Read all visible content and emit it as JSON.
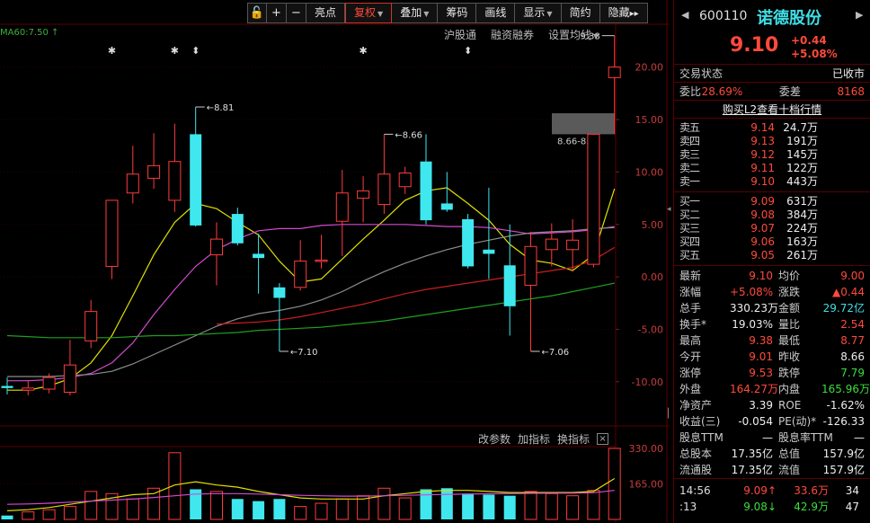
{
  "toolbar": {
    "buttons": [
      {
        "label": "亮点"
      },
      {
        "label": "复权",
        "active": true,
        "caret": true
      },
      {
        "label": "叠加",
        "caret": true
      },
      {
        "label": "筹码"
      },
      {
        "label": "画线"
      },
      {
        "label": "显示",
        "caret": true
      },
      {
        "label": "简约"
      },
      {
        "label": "隐藏"
      }
    ],
    "hide_arrows": "▸▸"
  },
  "ma60_label": "MA60:7.50",
  "ma60_arrow": "↑",
  "sublinks": [
    "沪股通",
    "融资融券",
    "设置均线"
  ],
  "indicator_bar": [
    "改参数",
    "加指标",
    "换指标"
  ],
  "indicator_close": "×",
  "chart_data": {
    "type": "candlestick",
    "y_axis_ticks": [
      "20.00",
      "15.00",
      "10.00",
      "5.00",
      "0.00",
      "-5.00",
      "-10.00"
    ],
    "y_axis_values": [
      20,
      15,
      10,
      5,
      0,
      -5,
      -10
    ],
    "ylim": [
      -11.3,
      22.8
    ],
    "volume_axis_ticks": [
      "330.00",
      "165.00"
    ],
    "volume_axis_values": [
      330,
      165
    ],
    "volume_ylim": [
      0,
      330
    ],
    "candles": [
      {
        "o": -10.4,
        "h": -9.6,
        "l": -11.2,
        "c": -10.6,
        "up": false
      },
      {
        "o": -10.8,
        "h": -9.9,
        "l": -11.3,
        "c": -10.6,
        "up": true
      },
      {
        "o": -10.7,
        "h": -9.2,
        "l": -11.1,
        "c": -9.6,
        "up": true
      },
      {
        "o": -11.0,
        "h": -6.0,
        "l": -11.3,
        "c": -8.4,
        "up": true
      },
      {
        "o": -6.1,
        "h": -2.2,
        "l": -6.8,
        "c": -3.3,
        "up": true
      },
      {
        "o": 1.0,
        "h": 7.2,
        "l": -0.2,
        "c": 7.3,
        "up": true
      },
      {
        "o": 8.0,
        "h": 12.5,
        "l": 7.0,
        "c": 9.8,
        "up": true
      },
      {
        "o": 10.6,
        "h": 13.7,
        "l": 8.4,
        "c": 9.4,
        "up": true
      },
      {
        "o": 7.3,
        "h": 14.6,
        "l": 6.2,
        "c": 11.0,
        "up": true
      },
      {
        "o": 13.6,
        "h": 16.2,
        "l": 4.8,
        "c": 4.9,
        "up": false
      },
      {
        "o": 2.1,
        "h": 5.2,
        "l": -0.8,
        "c": 3.6,
        "up": true
      },
      {
        "o": 6.0,
        "h": 6.6,
        "l": 3.0,
        "c": 3.2,
        "up": false
      },
      {
        "o": 2.2,
        "h": 4.1,
        "l": -1.6,
        "c": 1.8,
        "up": false
      },
      {
        "o": -1.0,
        "h": -0.6,
        "l": -7.1,
        "c": -2.0,
        "up": false
      },
      {
        "o": -1.0,
        "h": 3.5,
        "l": -1.3,
        "c": 1.5,
        "up": true
      },
      {
        "o": 1.6,
        "h": 4.0,
        "l": 0.8,
        "c": 1.5,
        "up": true
      },
      {
        "o": 5.3,
        "h": 10.2,
        "l": 2.0,
        "c": 8.0,
        "up": true
      },
      {
        "o": 7.5,
        "h": 9.6,
        "l": 5.2,
        "c": 8.2,
        "up": true
      },
      {
        "o": 6.9,
        "h": 13.6,
        "l": 6.0,
        "c": 9.8,
        "up": true
      },
      {
        "o": 8.6,
        "h": 10.5,
        "l": 7.9,
        "c": 9.9,
        "up": true
      },
      {
        "o": 11.0,
        "h": 13.6,
        "l": 5.0,
        "c": 5.4,
        "up": false
      },
      {
        "o": 7.0,
        "h": 10.0,
        "l": 6.2,
        "c": 6.4,
        "up": false
      },
      {
        "o": 5.5,
        "h": 6.0,
        "l": 0.8,
        "c": 1.0,
        "up": false
      },
      {
        "o": 2.6,
        "h": 8.5,
        "l": -0.2,
        "c": 2.2,
        "up": false
      },
      {
        "o": 1.1,
        "h": 5.0,
        "l": -5.6,
        "c": -2.8,
        "up": false
      },
      {
        "o": -0.8,
        "h": 4.3,
        "l": -7.1,
        "c": 2.9,
        "up": true
      },
      {
        "o": 2.6,
        "h": 5.1,
        "l": 1.0,
        "c": 3.6,
        "up": true
      },
      {
        "o": 2.6,
        "h": 5.5,
        "l": 0.5,
        "c": 3.5,
        "up": true
      },
      {
        "o": 1.2,
        "h": 13.6,
        "l": 0.9,
        "c": 13.6,
        "up": true
      },
      {
        "o": 19.0,
        "h": 23.0,
        "l": 13.6,
        "c": 20.0,
        "up": true
      }
    ],
    "ma_lines": [
      {
        "color": "#e0e000",
        "values": [
          -10.8,
          -10.8,
          -10.4,
          -9.7,
          -8.2,
          -5.6,
          -1.8,
          2.1,
          5.2,
          7.0,
          6.5,
          5.2,
          4.0,
          1.5,
          -0.5,
          -0.2,
          1.7,
          3.6,
          5.4,
          7.3,
          8.2,
          8.5,
          7.0,
          5.4,
          3.1,
          1.6,
          1.3,
          0.6,
          2.1,
          8.4
        ]
      },
      {
        "color": "#d14bd1",
        "values": [
          -9.9,
          -9.9,
          -9.8,
          -9.6,
          -9.2,
          -8.2,
          -6.3,
          -3.6,
          -1.2,
          1.0,
          2.6,
          3.6,
          4.4,
          4.6,
          4.6,
          4.9,
          5.0,
          5.0,
          5.0,
          5.0,
          4.9,
          4.8,
          4.8,
          4.7,
          4.4,
          4.1,
          4.2,
          4.3,
          4.5,
          4.8
        ]
      },
      {
        "color": "#8c8c8c",
        "values": [
          -9.5,
          -9.5,
          -9.5,
          -9.4,
          -9.3,
          -9.0,
          -8.3,
          -7.4,
          -6.5,
          -5.6,
          -4.7,
          -4.0,
          -3.5,
          -3.2,
          -2.8,
          -2.2,
          -1.4,
          -0.4,
          0.5,
          1.3,
          2.0,
          2.6,
          3.1,
          3.5,
          3.9,
          4.2,
          4.3,
          4.4,
          4.6,
          4.7
        ]
      },
      {
        "color": "#c81e1e",
        "values": [
          null,
          null,
          null,
          null,
          null,
          null,
          null,
          null,
          null,
          null,
          -4.5,
          -4.4,
          -4.3,
          -4.1,
          -3.8,
          -3.4,
          -3.0,
          -2.6,
          -2.1,
          -1.6,
          -1.2,
          -0.9,
          -0.6,
          -0.3,
          0.0,
          0.3,
          0.6,
          0.9,
          1.6,
          2.8
        ]
      },
      {
        "color": "#1f9e1f",
        "values": [
          -5.6,
          -5.7,
          -5.8,
          -5.8,
          -5.8,
          -5.8,
          -5.7,
          -5.6,
          -5.6,
          -5.5,
          -5.4,
          -5.3,
          -5.1,
          -5.0,
          -4.9,
          -4.8,
          -4.6,
          -4.4,
          -4.2,
          -3.9,
          -3.6,
          -3.3,
          -3.0,
          -2.7,
          -2.4,
          -2.1,
          -1.8,
          -1.4,
          -1.0,
          -0.6
        ]
      }
    ],
    "volume": [
      18,
      35,
      45,
      60,
      130,
      120,
      95,
      145,
      310,
      140,
      130,
      95,
      85,
      95,
      60,
      75,
      95,
      110,
      145,
      100,
      140,
      145,
      120,
      115,
      110,
      130,
      120,
      110,
      135,
      330
    ],
    "vol_ma": [
      {
        "color": "#e0e000",
        "values": [
          40,
          45,
          55,
          70,
          85,
          100,
          115,
          120,
          160,
          175,
          160,
          150,
          130,
          115,
          100,
          95,
          95,
          95,
          110,
          120,
          130,
          135,
          135,
          130,
          125,
          125,
          125,
          125,
          130,
          190
        ]
      },
      {
        "color": "#d14bd1",
        "values": [
          70,
          72,
          75,
          80,
          85,
          90,
          95,
          102,
          110,
          118,
          120,
          120,
          118,
          115,
          112,
          110,
          108,
          108,
          110,
          112,
          114,
          116,
          118,
          119,
          120,
          121,
          122,
          122,
          124,
          135
        ]
      }
    ],
    "annotations": [
      {
        "text": "8.81",
        "candle": 9,
        "value": 16.2,
        "anchor": "high"
      },
      {
        "text": "8.66",
        "candle": 18,
        "value": 13.6,
        "anchor": "high"
      },
      {
        "text": "7.10",
        "candle": 13,
        "value": -7.1,
        "anchor": "low"
      },
      {
        "text": "7.06",
        "candle": 25,
        "value": -7.1,
        "anchor": "low"
      },
      {
        "text": "9.38",
        "candle": 29,
        "value": 23.0,
        "anchor": "high-left"
      }
    ],
    "price_band_label": "8.66-8.77",
    "markers": [
      {
        "candle": 5,
        "glyph": "✱"
      },
      {
        "candle": 8,
        "glyph": "✱"
      },
      {
        "candle": 9,
        "glyph": "⬍"
      },
      {
        "candle": 17,
        "glyph": "✱"
      },
      {
        "candle": 22,
        "glyph": "⬍"
      }
    ]
  },
  "panel": {
    "code": "600110",
    "name": "诺德股份",
    "price": "9.10",
    "change": "+0.44",
    "change_pct": "+5.08%",
    "status_label": "交易状态",
    "status_value": "已收市",
    "ratio_label": "委比",
    "ratio_value": "28.69%",
    "diff_label": "委差",
    "diff_value": "8168",
    "l2_link": "购买L2查看十档行情",
    "asks": [
      {
        "label": "卖五",
        "price": "9.14",
        "vol": "24.7万"
      },
      {
        "label": "卖四",
        "price": "9.13",
        "vol": "191万"
      },
      {
        "label": "卖三",
        "price": "9.12",
        "vol": "145万"
      },
      {
        "label": "卖二",
        "price": "9.11",
        "vol": "122万"
      },
      {
        "label": "卖一",
        "price": "9.10",
        "vol": "443万"
      }
    ],
    "bids": [
      {
        "label": "买一",
        "price": "9.09",
        "vol": "631万"
      },
      {
        "label": "买二",
        "price": "9.08",
        "vol": "384万"
      },
      {
        "label": "买三",
        "price": "9.07",
        "vol": "224万"
      },
      {
        "label": "买四",
        "price": "9.06",
        "vol": "163万"
      },
      {
        "label": "买五",
        "price": "9.05",
        "vol": "261万"
      }
    ],
    "quotes": [
      {
        "a": "最新",
        "b": "9.10",
        "bc": "red",
        "c": "均价",
        "d": "9.00",
        "dc": "red"
      },
      {
        "a": "涨幅",
        "b": "+5.08%",
        "bc": "red",
        "c": "涨跌",
        "d": "▲0.44",
        "dc": "red"
      },
      {
        "a": "总手",
        "b": "330.23万",
        "bc": "white",
        "c": "金额",
        "d": "29.72亿",
        "dc": "cyan"
      },
      {
        "a": "换手*",
        "b": "19.03%",
        "bc": "white",
        "c": "量比",
        "d": "2.54",
        "dc": "red"
      },
      {
        "a": "最高",
        "b": "9.38",
        "bc": "red",
        "c": "最低",
        "d": "8.77",
        "dc": "red"
      },
      {
        "a": "今开",
        "b": "9.01",
        "bc": "red",
        "c": "昨收",
        "d": "8.66",
        "dc": "white"
      },
      {
        "a": "涨停",
        "b": "9.53",
        "bc": "red",
        "c": "跌停",
        "d": "7.79",
        "dc": "green"
      },
      {
        "a": "外盘",
        "b": "164.27万",
        "bc": "red",
        "c": "内盘",
        "d": "165.96万",
        "dc": "green"
      },
      {
        "a": "净资产",
        "b": "3.39",
        "bc": "white",
        "c": "ROE",
        "d": "-1.62%",
        "dc": "white"
      },
      {
        "a": "收益(三)",
        "b": "-0.054",
        "bc": "white",
        "c": "PE(动)*",
        "d": "-126.33",
        "dc": "white"
      },
      {
        "a": "股息TTM",
        "b": "—",
        "bc": "white",
        "c": "股息率TTM",
        "d": "—",
        "dc": "white"
      },
      {
        "a": "总股本",
        "b": "17.35亿",
        "bc": "white",
        "c": "总值",
        "d": "157.9亿",
        "dc": "white"
      },
      {
        "a": "流通股",
        "b": "17.35亿",
        "bc": "white",
        "c": "流值",
        "d": "157.9亿",
        "dc": "white"
      }
    ],
    "ticks": [
      {
        "t": "14:56",
        "p": "9.09",
        "dir": "↑",
        "pc": "red",
        "v": "33.6万",
        "vc": "red",
        "n": "34"
      },
      {
        "t": ":13",
        "p": "9.08",
        "dir": "↓",
        "pc": "green",
        "v": "42.9万",
        "vc": "green",
        "n": "47"
      }
    ]
  }
}
